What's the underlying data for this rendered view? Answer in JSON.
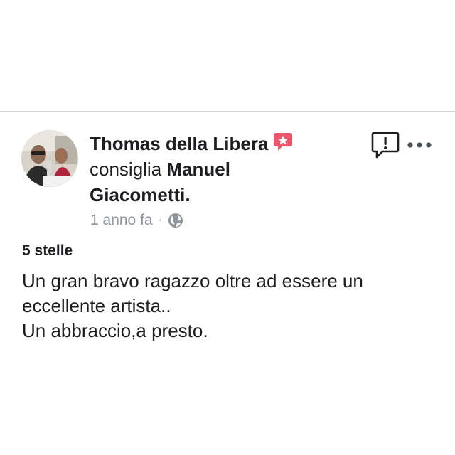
{
  "post": {
    "author": "Thomas della Libera",
    "action": "consiglia",
    "page_name": "Manuel Giacometti.",
    "time": "1 anno fa",
    "separator": "·",
    "audience_icon": "globe-icon",
    "badge_icon": "recommendation-star-icon",
    "report_icon": "report-speech-bubble-icon",
    "more_icon": "more-dots-icon"
  },
  "review": {
    "rating": "5 stelle",
    "lines": [
      "Un gran bravo ragazzo oltre ad essere un",
      "eccellente artista..",
      "Un abbraccio,a presto."
    ]
  },
  "colors": {
    "text": "#1c1e21",
    "meta": "#8d949e",
    "badge": "#f0566b",
    "divider": "#cfd2d6"
  }
}
